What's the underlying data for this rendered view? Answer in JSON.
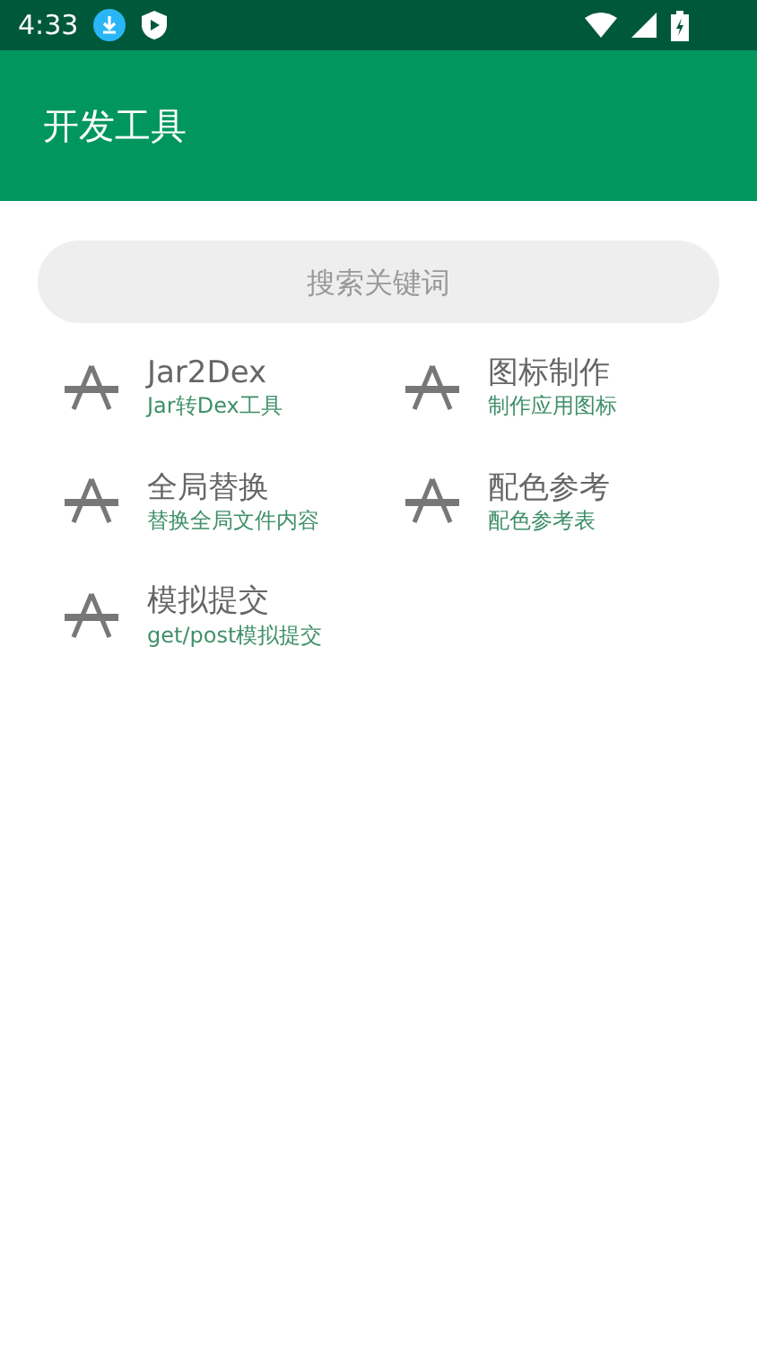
{
  "status_bar": {
    "time": "4:33"
  },
  "app_bar": {
    "title": "开发工具"
  },
  "search": {
    "placeholder": "搜索关键词"
  },
  "tools": [
    {
      "title": "Jar2Dex",
      "subtitle": "Jar转Dex工具"
    },
    {
      "title": "图标制作",
      "subtitle": "制作应用图标"
    },
    {
      "title": "全局替换",
      "subtitle": "替换全局文件内容"
    },
    {
      "title": "配色参考",
      "subtitle": "配色参考表"
    },
    {
      "title": "模拟提交",
      "subtitle": "get/post模拟提交"
    }
  ]
}
